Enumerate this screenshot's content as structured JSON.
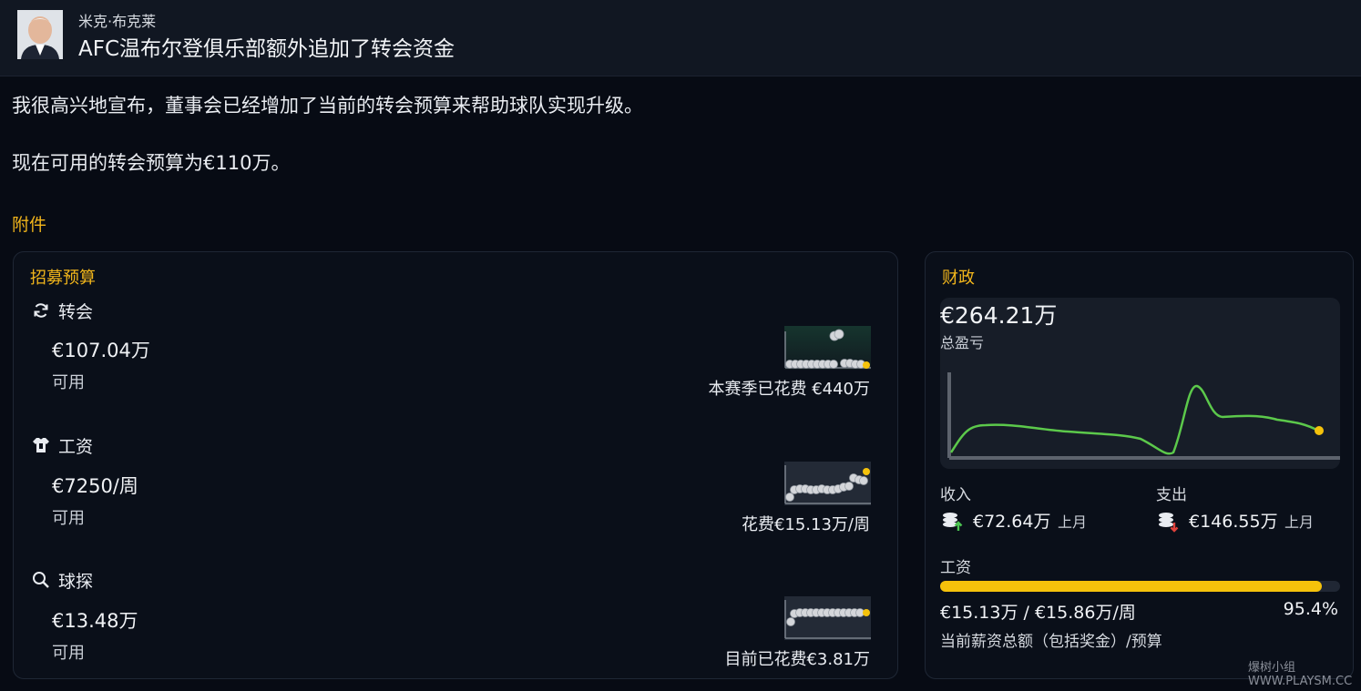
{
  "message": {
    "sender": "米克·布克莱",
    "subject": "AFC温布尔登俱乐部额外追加了转会资金",
    "body_line1": "我很高兴地宣布，董事会已经增加了当前的转会预算来帮助球队实现升级。",
    "body_line2": "现在可用的转会预算为€110万。",
    "attachments_label": "附件"
  },
  "recruitment": {
    "title": "招募预算",
    "transfer": {
      "label": "转会",
      "icon": "refresh-icon",
      "amount": "€107.04万",
      "status": "可用",
      "spent": "本赛季已花费 €440万"
    },
    "wages": {
      "label": "工资",
      "icon": "shirt-icon",
      "amount": "€7250/周",
      "status": "可用",
      "spent": "花费€15.13万/周"
    },
    "scouting": {
      "label": "球探",
      "icon": "search-icon",
      "amount": "€13.48万",
      "status": "可用",
      "spent": "目前已花费€3.81万"
    }
  },
  "finance": {
    "title": "财政",
    "balance": "€264.21万",
    "balance_label": "总盈亏",
    "income_label": "收入",
    "income_value": "€72.64万",
    "income_period": "上月",
    "expense_label": "支出",
    "expense_value": "€146.55万",
    "expense_period": "上月",
    "wages_label": "工资",
    "wages_value": "€15.13万 / €15.86万/周",
    "wages_percent": "95.4%",
    "wages_fraction": 0.954,
    "wages_desc": "当前薪资总额（包括奖金）/预算"
  },
  "watermark": "爆树小组 WWW.PLAYSM.CC",
  "colors": {
    "accent": "#f1b51b",
    "line": "#5cc94b",
    "bar": "#f5c20b",
    "income_arrow": "#4cc552",
    "expense_arrow": "#e0413b"
  }
}
